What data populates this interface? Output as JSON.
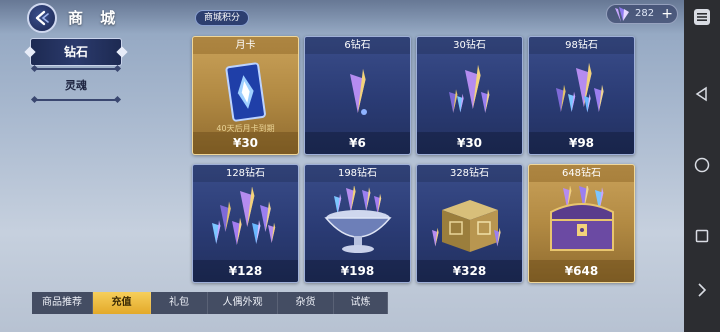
{
  "header": {
    "title": "商 城",
    "points_label": "商城积分",
    "currency_amount": "282",
    "currency_add": "+"
  },
  "sidebar": {
    "items": [
      {
        "label": "钻石",
        "active": true
      },
      {
        "label": "灵魂",
        "active": false
      }
    ]
  },
  "products": [
    {
      "name": "月卡",
      "price": "¥30",
      "note": "40天后月卡到期",
      "style": "gold",
      "art": "card"
    },
    {
      "name": "6钻石",
      "price": "¥6",
      "style": "blue",
      "art": "gem-small"
    },
    {
      "name": "30钻石",
      "price": "¥30",
      "style": "blue",
      "art": "gem-cluster"
    },
    {
      "name": "98钻石",
      "price": "¥98",
      "style": "blue",
      "art": "gem-cluster-lg"
    },
    {
      "name": "128钻石",
      "price": "¥128",
      "style": "blue",
      "art": "gem-pile"
    },
    {
      "name": "198钻石",
      "price": "¥198",
      "style": "blue",
      "art": "gem-bowl"
    },
    {
      "name": "328钻石",
      "price": "¥328",
      "style": "blue",
      "art": "gem-box"
    },
    {
      "name": "648钻石",
      "price": "¥648",
      "style": "gold",
      "art": "gem-chest"
    }
  ],
  "bottom_tabs": [
    {
      "label": "商品推荐",
      "active": false
    },
    {
      "label": "充值",
      "active": true
    },
    {
      "label": "礼包",
      "active": false
    },
    {
      "label": "人偶外观",
      "active": false
    },
    {
      "label": "杂货",
      "active": false
    },
    {
      "label": "试炼",
      "active": false
    }
  ],
  "icons": {
    "back": "back-arrow-icon",
    "currency": "diamond-icon",
    "nav_menu": "menu-icon",
    "nav_back": "triangle-back-icon",
    "nav_home": "circle-home-icon",
    "nav_recent": "square-recent-icon",
    "nav_expand": "chevron-right-icon"
  },
  "colors": {
    "accent_gold": "#e3a92a",
    "panel_blue": "#2a3b74",
    "navbar": "#2c2d31"
  }
}
